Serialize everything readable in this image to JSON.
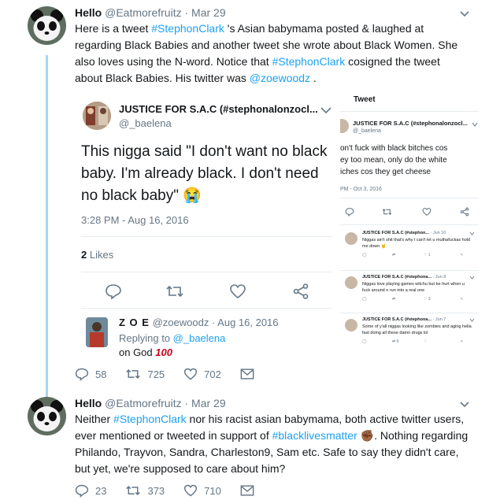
{
  "tweets": [
    {
      "name": "Hello",
      "handle": "@Eatmorefruitz",
      "sep": " · ",
      "date": "Mar 29",
      "text_parts": [
        {
          "t": "Here is a tweet ",
          "hl": false
        },
        {
          "t": "#StephonClark",
          "hl": true
        },
        {
          "t": " 's Asian babymama posted & laughed at regarding Black Babies and another tweet she wrote about Black Women. She also loves using the N-word. Notice that ",
          "hl": false
        },
        {
          "t": "#StephonClark",
          "hl": true
        },
        {
          "t": " cosigned the tweet about Black Babies. His twitter was ",
          "hl": false
        },
        {
          "t": "@zoewoodz",
          "hl": true
        },
        {
          "t": " .",
          "hl": false
        }
      ],
      "replies": "58",
      "retweets": "725",
      "likes": "702"
    },
    {
      "name": "Hello",
      "handle": "@Eatmorefruitz",
      "sep": " · ",
      "date": "Mar 29",
      "text_parts": [
        {
          "t": "Neither ",
          "hl": false
        },
        {
          "t": "#StephonClark",
          "hl": true
        },
        {
          "t": " nor his racist asian babymama, both active twitter users, ever mentioned or tweeted in support of ",
          "hl": false
        },
        {
          "t": "#blacklivesmatter",
          "hl": true
        },
        {
          "t": " ✊🏾. Nothing regarding Philando, Trayvon, Sandra, Charleston9, Sam etc. Safe to say they didn't care, but yet, we're supposed to care about him?",
          "hl": false
        }
      ],
      "replies": "23",
      "retweets": "373",
      "likes": "710"
    }
  ],
  "card1": {
    "name": "JUSTICE FOR S.A.C (#stephonalonzocl...",
    "handle": "@_baelena",
    "text": "This nigga said \"I don't want no black baby. I'm already black. I don't need no black baby\" 😭",
    "time": "3:28 PM - Aug 16, 2016",
    "likes_count": "2",
    "likes_label": " Likes",
    "reply": {
      "name": "Z O E",
      "handle": "@zoewoodz",
      "sep": " · ",
      "date": "Aug 16, 2016",
      "replying_label": "Replying to ",
      "replying_to": "@_baelena",
      "text": "on God ",
      "emoji": "100"
    }
  },
  "card2": {
    "header": "Tweet",
    "name": "JUSTICE FOR S.A.C (#stephonalonzocl...",
    "handle": "@_baelena",
    "lines": [
      "on't fuck with black bitches cos",
      "ey too mean, only do the white",
      "iches cos they get cheese"
    ],
    "time": "PM - Oct 3, 2016",
    "minis": [
      {
        "name": "JUSTICE FOR S.A.C (#stephon...",
        "date": "· Jun 10",
        "text": "Niggas ain't shit that's why I can't let u muthafuckas hold me down 🤘",
        "likes": "1"
      },
      {
        "name": "JUSTICE FOR S.A.C (#stephona...",
        "date": "· Jun 8",
        "text": "Niggas love playing games witchu but be hurt when u fuck around n run into a real one",
        "likes": "3"
      },
      {
        "name": "JUSTICE FOR S.A.C (#stephona...",
        "date": "· Jun 7",
        "text": "Some of y'all niggas looking like zombies and aging hella fast doing all these damn drugs lol",
        "likes": "9"
      }
    ]
  },
  "icons": [
    "panda-avatar",
    "chevron-down-icon",
    "reply-icon",
    "retweet-icon",
    "like-icon",
    "message-icon",
    "share-icon"
  ],
  "colors": {
    "link": "#1da1f2",
    "muted": "#657786",
    "thread": "#a6d4f2",
    "text": "#14171a"
  }
}
